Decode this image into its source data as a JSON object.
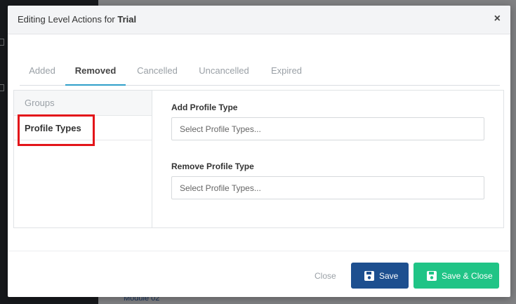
{
  "background": {
    "module_link": "Module 02"
  },
  "modal": {
    "title_prefix": "Editing Level Actions for ",
    "title_level": "Trial",
    "close_symbol": "×"
  },
  "tabs": [
    {
      "label": "Added",
      "active": false
    },
    {
      "label": "Removed",
      "active": true
    },
    {
      "label": "Cancelled",
      "active": false
    },
    {
      "label": "Uncancelled",
      "active": false
    },
    {
      "label": "Expired",
      "active": false
    }
  ],
  "side_menu": {
    "groups_label": "Groups",
    "profile_types_label": "Profile Types",
    "selected": "Profile Types"
  },
  "form": {
    "add_label": "Add Profile Type",
    "add_placeholder": "Select Profile Types...",
    "remove_label": "Remove Profile Type",
    "remove_placeholder": "Select Profile Types..."
  },
  "footer": {
    "close_label": "Close",
    "save_label": "Save",
    "save_close_label": "Save & Close"
  },
  "colors": {
    "accent_tab": "#2f9fc9",
    "save_button": "#1d4f8f",
    "save_close_button": "#20c486",
    "highlight": "#e3151a"
  },
  "icons": {
    "save": "floppy-disk-icon",
    "close": "close-icon"
  }
}
